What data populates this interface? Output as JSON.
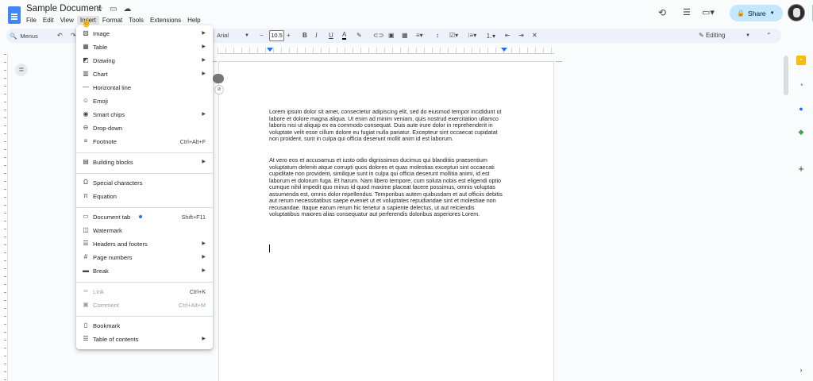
{
  "doc_title": "Sample Document",
  "menubar": [
    "File",
    "Edit",
    "View",
    "Insert",
    "Format",
    "Tools",
    "Extensions",
    "Help"
  ],
  "active_menu": "Insert",
  "share_label": "Share",
  "toolbar": {
    "menus_label": "Menus",
    "font_name": "Arial",
    "font_size": "10.5",
    "editing_label": "Editing"
  },
  "insert_menu": {
    "items": [
      {
        "label": "Image",
        "icon": "image-icon",
        "submenu": true
      },
      {
        "label": "Table",
        "icon": "table-icon",
        "submenu": true
      },
      {
        "label": "Drawing",
        "icon": "drawing-icon",
        "submenu": true
      },
      {
        "label": "Chart",
        "icon": "chart-icon",
        "submenu": true
      },
      {
        "label": "Horizontal line",
        "icon": "horizontal-line-icon"
      },
      {
        "label": "Emoji",
        "icon": "emoji-icon"
      },
      {
        "label": "Smart chips",
        "icon": "smart-chips-icon",
        "submenu": true
      },
      {
        "label": "Drop-down",
        "icon": "dropdown-icon"
      },
      {
        "label": "Footnote",
        "icon": "footnote-icon",
        "shortcut": "Ctrl+Alt+F"
      },
      {
        "label": "Building blocks",
        "icon": "building-blocks-icon",
        "submenu": true
      },
      {
        "label": "Special characters",
        "icon": "omega-icon"
      },
      {
        "label": "Equation",
        "icon": "pi-icon"
      },
      {
        "label": "Document tab",
        "icon": "document-tab-icon",
        "shortcut": "Shift+F11"
      },
      {
        "label": "Watermark",
        "icon": "watermark-icon"
      },
      {
        "label": "Headers and footers",
        "icon": "headers-footers-icon",
        "submenu": true
      },
      {
        "label": "Page numbers",
        "icon": "page-numbers-icon",
        "submenu": true
      },
      {
        "label": "Break",
        "icon": "break-icon",
        "submenu": true
      },
      {
        "label": "Link",
        "icon": "link-icon",
        "shortcut": "Ctrl+K"
      },
      {
        "label": "Comment",
        "icon": "comment-icon",
        "shortcut": "Ctrl+Alt+M",
        "disabled": true
      },
      {
        "label": "Bookmark",
        "icon": "bookmark-icon"
      },
      {
        "label": "Table of contents",
        "icon": "toc-icon",
        "submenu": true
      }
    ]
  },
  "document": {
    "paragraphs": [
      "Lorem ipsum dolor sit amet, consectetur adipiscing elit, sed do eiusmod tempor incididunt ut labore et dolore magna aliqua. Ut enim ad minim veniam, quis nostrud exercitation ullamco laboris nisi ut aliquip ex ea commodo consequat. Duis aute irure dolor in reprehenderit in voluptate velit esse cillum dolore eu fugiat nulla pariatur. Excepteur sint occaecat cupidatat non proident, sunt in culpa qui officia deserunt mollit anim id est laborum.",
      "At vero eos et accusamus et iusto odio dignissimos ducimus qui blanditiis praesentium voluptatum deleniti atque corrupti quos dolores et quas molestias excepturi sint occaecati cupiditate non provident, similique sunt in culpa qui officia deserunt mollitia animi, id est laborum et dolorum fuga. Et harum. Nam libero tempore, cum soluta nobis est eligendi optio cumque nihil impedit quo minus id quod maxime placeat facere possimus, omnis voluptas assumenda est, omnis dolor repellendus. Temporibus autem quibusdam et aut officiis debitis aut rerum necessitatibus saepe eveniet ut et voluptates repudiandae sint et molestiae non recusandae. Itaque earum rerum hic tenetur a sapiente delectus, ut aut reiciendis voluptatibus maiores alias consequatur aut perferendis doloribus asperiores Lorem."
    ]
  },
  "colors": {
    "accent": "#1a73e8",
    "share_bg": "#c2e7ff",
    "doc_icon": "#4285f4"
  }
}
